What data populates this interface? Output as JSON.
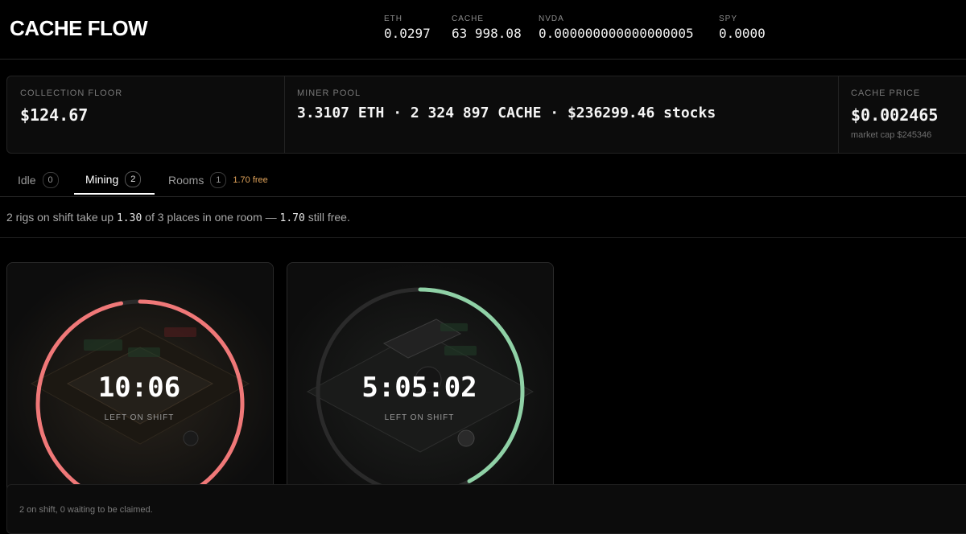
{
  "app": {
    "title": "CACHE FLOW"
  },
  "tickers": [
    {
      "label": "ETH",
      "value": "0.0297"
    },
    {
      "label": "CACHE",
      "value": "63 998.08"
    },
    {
      "label": "NVDA",
      "value": "0.000000000000000005"
    },
    {
      "label": "SPY",
      "value": "0.0000"
    }
  ],
  "stats": {
    "collection_floor": {
      "label": "COLLECTION FLOOR",
      "value": "$124.67"
    },
    "miner_pool": {
      "label": "MINER POOL",
      "value": "3.3107 ETH · 2 324 897 CACHE · $236299.46 stocks"
    },
    "cache_price": {
      "label": "CACHE PRICE",
      "value": "$0.002465",
      "sub": "market cap $245346"
    }
  },
  "tabs": [
    {
      "label": "Idle",
      "count": "0"
    },
    {
      "label": "Mining",
      "count": "2",
      "active": true
    },
    {
      "label": "Rooms",
      "count": "1",
      "note": "1.70 free"
    }
  ],
  "summary": {
    "prefix": "2 rigs on shift take up",
    "used": "1.30",
    "mid": "of",
    "total": "3",
    "mid2": "places in one room —",
    "free": "1.70",
    "suffix": "still free."
  },
  "rigs": [
    {
      "time": "10:06",
      "label": "LEFT ON SHIFT",
      "progress": 0.97,
      "color": "#f07878",
      "theme": "red"
    },
    {
      "time": "5:05:02",
      "label": "LEFT ON SHIFT",
      "progress": 0.42,
      "color": "#8fd1a6",
      "theme": "green"
    }
  ],
  "footer": {
    "text": "2 on shift, 0 waiting to be claimed."
  },
  "colors": {
    "accent_red": "#f07878",
    "accent_green": "#8fd1a6",
    "note_orange": "#e0a35a"
  }
}
